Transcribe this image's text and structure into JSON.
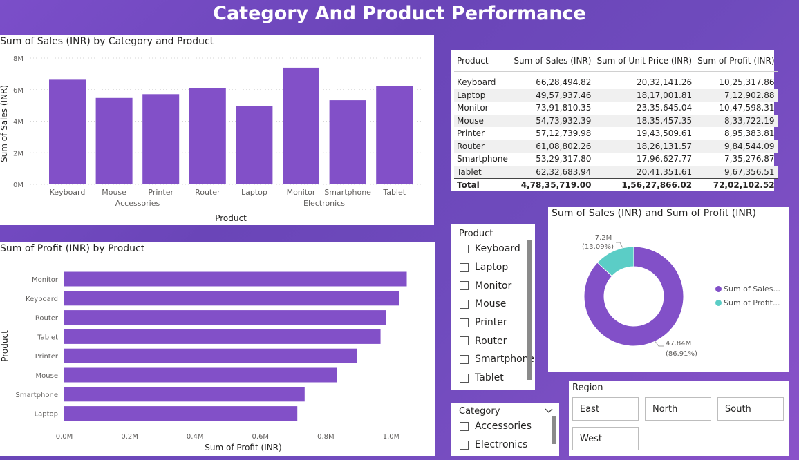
{
  "title": "Category And Product Performance",
  "colors": {
    "primary": "#8250c8",
    "secondary": "#5bcdc6"
  },
  "column_chart": {
    "title": "Sum of Sales (INR) by Category and Product",
    "ylabel": "Sum of Sales (INR)",
    "xlabel": "Product",
    "yticks": [
      "0M",
      "2M",
      "4M",
      "6M",
      "8M"
    ],
    "group_labels": [
      "Accessories",
      "Electronics"
    ]
  },
  "bar_chart": {
    "title": "Sum of Profit (INR) by Product",
    "ylabel": "Product",
    "xlabel": "Sum of Profit (INR)",
    "xticks": [
      "0.0M",
      "0.2M",
      "0.4M",
      "0.6M",
      "0.8M",
      "1.0M"
    ]
  },
  "table": {
    "headers": [
      "Product",
      "Sum of Sales (INR)",
      "Sum of Unit Price (INR)",
      "Sum of Profit (INR)"
    ],
    "rows": [
      [
        "Keyboard",
        "66,28,494.82",
        "20,32,141.26",
        "10,25,317.86"
      ],
      [
        "Laptop",
        "49,57,937.46",
        "18,17,001.81",
        "7,12,902.88"
      ],
      [
        "Monitor",
        "73,91,810.35",
        "23,35,645.04",
        "10,47,598.31"
      ],
      [
        "Mouse",
        "54,73,932.39",
        "18,35,457.35",
        "8,33,722.19"
      ],
      [
        "Printer",
        "57,12,739.98",
        "19,43,509.61",
        "8,95,383.81"
      ],
      [
        "Router",
        "61,08,802.26",
        "18,26,131.57",
        "9,84,544.09"
      ],
      [
        "Smartphone",
        "53,29,317.80",
        "17,96,627.77",
        "7,35,276.87"
      ],
      [
        "Tablet",
        "62,32,683.94",
        "20,41,351.61",
        "9,67,356.51"
      ]
    ],
    "total": [
      "Total",
      "4,78,35,719.00",
      "1,56,27,866.02",
      "72,02,102.52"
    ]
  },
  "donut": {
    "title": "Sum of Sales (INR) and Sum of Profit (INR)",
    "legend": [
      "Sum of Sales...",
      "Sum of Profit..."
    ],
    "label_sales_value": "47.84M",
    "label_sales_pct": "(86.91%)",
    "label_profit_value": "7.2M",
    "label_profit_pct": "(13.09%)"
  },
  "product_slicer": {
    "title": "Product",
    "items": [
      "Keyboard",
      "Laptop",
      "Monitor",
      "Mouse",
      "Printer",
      "Router",
      "Smartphone",
      "Tablet"
    ]
  },
  "category_slicer": {
    "title": "Category",
    "items": [
      "Accessories",
      "Electronics"
    ]
  },
  "region_slicer": {
    "title": "Region",
    "items": [
      "East",
      "North",
      "South",
      "West"
    ]
  },
  "chart_data": [
    {
      "type": "bar",
      "title": "Sum of Sales (INR) by Category and Product",
      "xlabel": "Product",
      "ylabel": "Sum of Sales (INR)",
      "ylim": [
        0,
        8000000
      ],
      "grid": true,
      "categories": [
        "Keyboard",
        "Mouse",
        "Printer",
        "Router",
        "Laptop",
        "Monitor",
        "Smartphone",
        "Tablet"
      ],
      "groups": [
        {
          "name": "Accessories",
          "categories": [
            "Keyboard",
            "Mouse",
            "Printer",
            "Router"
          ]
        },
        {
          "name": "Electronics",
          "categories": [
            "Laptop",
            "Monitor",
            "Smartphone",
            "Tablet"
          ]
        }
      ],
      "values": [
        6628494.82,
        5473932.39,
        5712739.98,
        6108802.26,
        4957937.46,
        7391810.35,
        5329317.8,
        6232683.94
      ]
    },
    {
      "type": "bar",
      "orientation": "horizontal",
      "title": "Sum of Profit (INR) by Product",
      "xlabel": "Sum of Profit (INR)",
      "ylabel": "Product",
      "xlim": [
        0,
        1100000
      ],
      "categories": [
        "Monitor",
        "Keyboard",
        "Router",
        "Tablet",
        "Printer",
        "Mouse",
        "Smartphone",
        "Laptop"
      ],
      "values": [
        1047598.31,
        1025317.86,
        984544.09,
        967356.51,
        895383.81,
        833722.19,
        735276.87,
        712902.88
      ]
    },
    {
      "type": "pie",
      "title": "Sum of Sales (INR) and Sum of Profit (INR)",
      "legend_position": "right",
      "categories": [
        "Sum of Sales (INR)",
        "Sum of Profit (INR)"
      ],
      "values": [
        47835719.0,
        7202102.52
      ]
    }
  ]
}
